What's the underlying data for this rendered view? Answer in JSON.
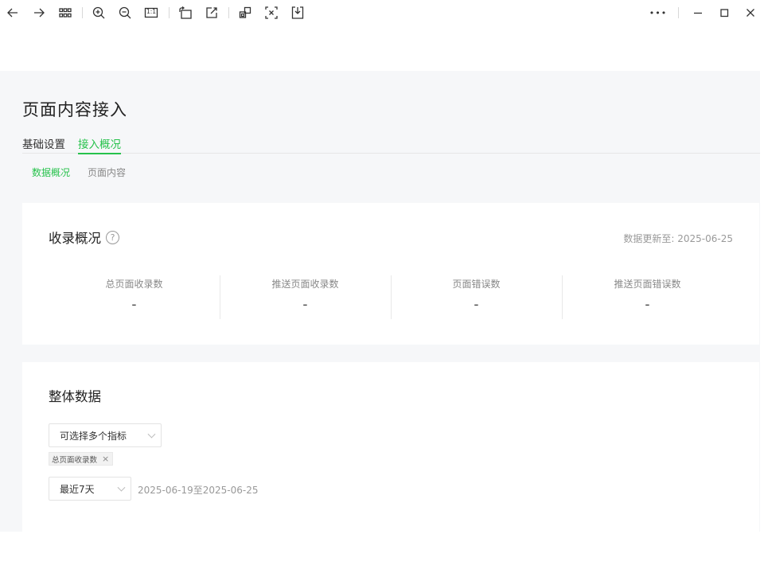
{
  "toolbar": {
    "icons": [
      "back-icon",
      "forward-icon",
      "grid-icon",
      "zoom-in-icon",
      "zoom-out-icon",
      "actual-size-icon",
      "rotate-icon",
      "edit-icon",
      "copy-icon",
      "crop-icon",
      "download-icon"
    ],
    "window_controls": [
      "more-icon",
      "minimize-icon",
      "maximize-icon",
      "close-icon"
    ],
    "actual_size_label": "1:1",
    "more_label": "•••"
  },
  "page": {
    "title": "页面内容接入",
    "tabs": [
      {
        "label": "基础设置",
        "active": false
      },
      {
        "label": "接入概况",
        "active": true
      }
    ],
    "subtabs": [
      {
        "label": "数据概况",
        "active": true
      },
      {
        "label": "页面内容",
        "active": false
      }
    ]
  },
  "overview": {
    "title": "收录概况",
    "help": "?",
    "update_time": "数据更新至: 2025-06-25",
    "stats": [
      {
        "label": "总页面收录数",
        "value": "-"
      },
      {
        "label": "推送页面收录数",
        "value": "-"
      },
      {
        "label": "页面错误数",
        "value": "-"
      },
      {
        "label": "推送页面错误数",
        "value": "-"
      }
    ]
  },
  "overall": {
    "title": "整体数据",
    "metric_select": "可选择多个指标",
    "selected_tags": [
      {
        "label": "总页面收录数",
        "close": "×"
      }
    ],
    "period_select": "最近7天",
    "date_range": "2025-06-19至2025-06-25"
  },
  "colors": {
    "accent": "#27c24c",
    "page_bg": "#f6f7f9"
  }
}
